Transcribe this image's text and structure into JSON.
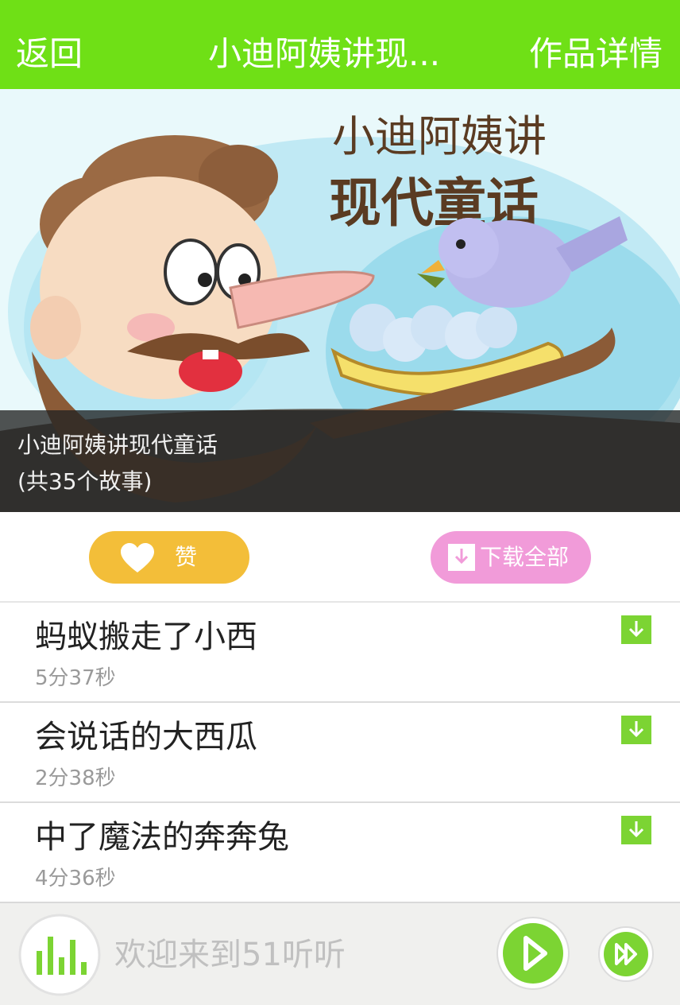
{
  "header": {
    "back_label": "返回",
    "title": "小迪阿姨讲现...",
    "detail_label": "作品详情"
  },
  "cover": {
    "art_title_line1": "小迪阿姨讲",
    "art_title_line2": "现代童话",
    "caption_title": "小迪阿姨讲现代童话",
    "caption_count": "(共35个故事)"
  },
  "actions": {
    "like_label": "赞",
    "download_all_label": "下载全部"
  },
  "stories": [
    {
      "name": "蚂蚁搬走了小西",
      "duration": "5分37秒"
    },
    {
      "name": "会说话的大西瓜",
      "duration": "2分38秒"
    },
    {
      "name": "中了魔法的奔奔兔",
      "duration": "4分36秒"
    }
  ],
  "player": {
    "welcome_text": "欢迎来到51听听"
  },
  "colors": {
    "brand_green": "#6fe016",
    "like_yellow": "#f3be39",
    "download_pink": "#f19bd9",
    "icon_green": "#7cd433"
  }
}
